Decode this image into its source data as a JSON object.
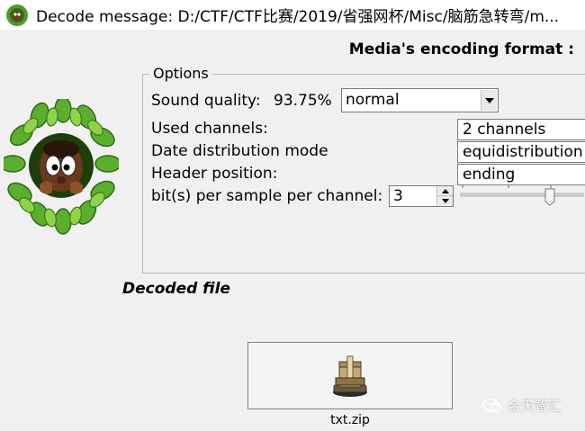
{
  "window": {
    "title": "Decode message: D:/CTF/CTF比赛/2019/省强网杯/Misc/脑筋急转弯/m..."
  },
  "header": {
    "format_label": "Media's encoding format :"
  },
  "options": {
    "legend": "Options",
    "sound_quality_label": "Sound quality:",
    "sound_quality_value": "93.75%",
    "sound_quality_select": "normal",
    "used_channels_label": "Used channels:",
    "used_channels_value": "2 channels",
    "date_distribution_label": "Date distribution mode",
    "date_distribution_value": "equidistribution",
    "header_position_label": "Header position:",
    "header_position_value": "ending",
    "bits_label": "bit(s) per sample per channel:",
    "bits_value": "3"
  },
  "decoded": {
    "label": "Decoded file",
    "file_name": "txt.zip"
  },
  "watermark": {
    "text": "合天智汇"
  },
  "icons": {
    "app": "app-icon",
    "mascot": "mascot-in-leaves-image",
    "dropdown": "chevron-down-icon",
    "archive": "archive-box-icon",
    "wechat": "wechat-icon"
  }
}
